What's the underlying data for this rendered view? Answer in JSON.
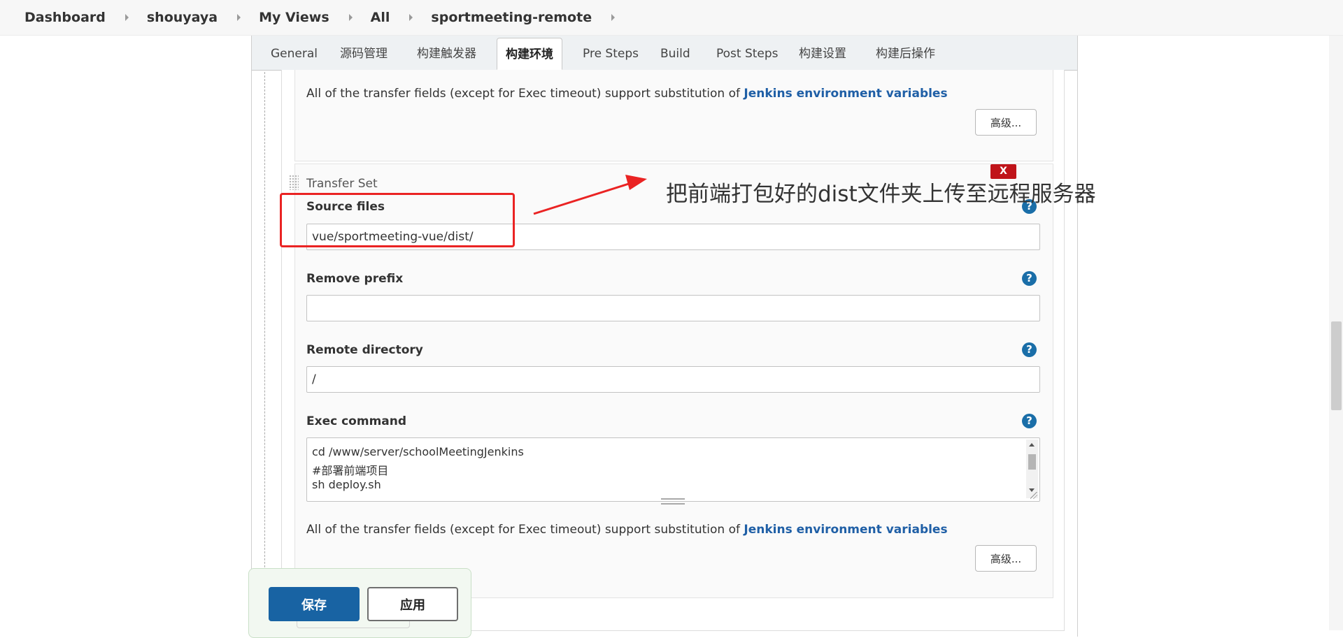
{
  "breadcrumb": {
    "items": [
      "Dashboard",
      "shouyaya",
      "My Views",
      "All",
      "sportmeeting-remote"
    ]
  },
  "tabs": [
    "General",
    "源码管理",
    "构建触发器",
    "构建环境",
    "Pre Steps",
    "Build",
    "Post Steps",
    "构建设置",
    "构建后操作"
  ],
  "active_tab": "构建环境",
  "info": {
    "prefix": "All of the transfer fields (except for Exec timeout) support substitution of ",
    "link": "Jenkins environment variables"
  },
  "advanced_label": "高级...",
  "transfer_set": {
    "title": "Transfer Set",
    "delete_label": "X",
    "source_files": {
      "label": "Source files",
      "value": "vue/sportmeeting-vue/dist/"
    },
    "remove_prefix": {
      "label": "Remove prefix",
      "value": ""
    },
    "remote_directory": {
      "label": "Remote directory",
      "value": "/"
    },
    "exec_command": {
      "label": "Exec command",
      "lines": [
        "cd /www/server/schoolMeetingJenkins",
        "#部署前端项目",
        "sh deploy.sh"
      ]
    }
  },
  "help_icon": "?",
  "annotation": {
    "text": "把前端打包好的dist文件夹上传至远程服务器",
    "color": "#ea2323"
  },
  "footer": {
    "save_label": "保存",
    "apply_label": "应用"
  },
  "colors": {
    "link": "#1f5fa6",
    "save_button": "#1863a3",
    "delete_button": "#c0141a",
    "help_icon": "#1a6ea8"
  }
}
